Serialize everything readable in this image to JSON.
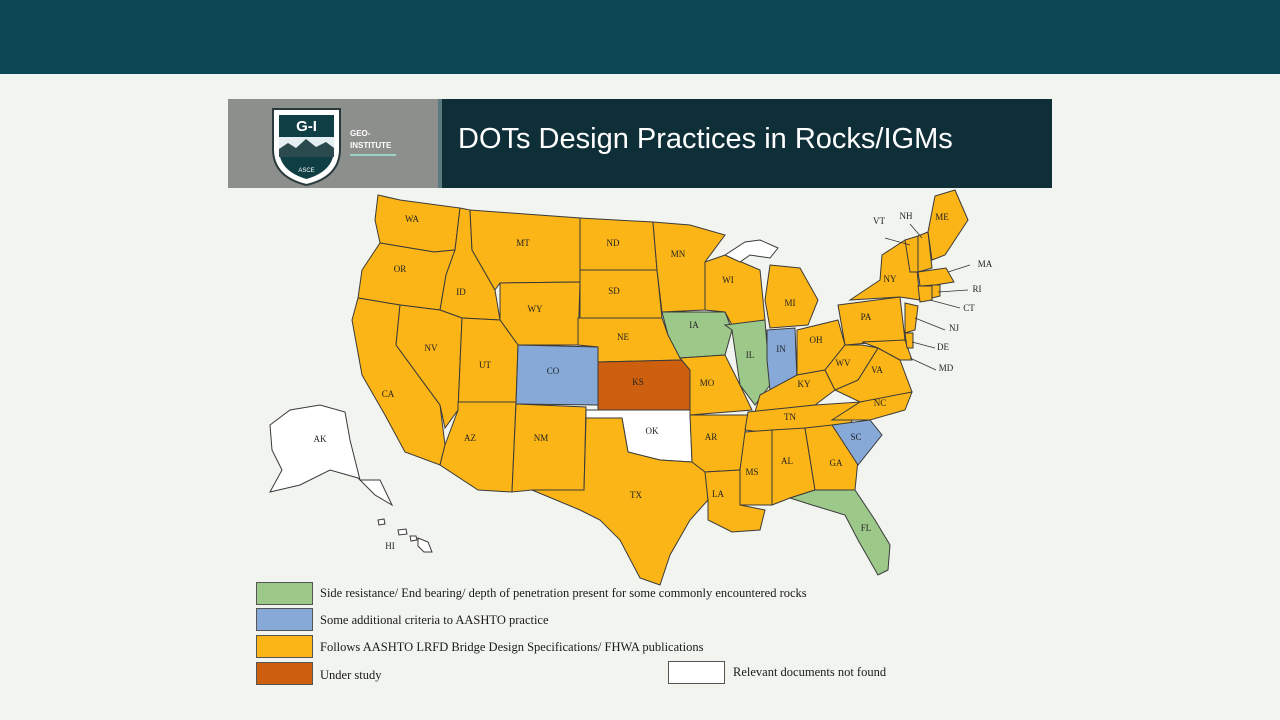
{
  "header": {
    "title": "DOTs Design Practices in Rocks/IGMs",
    "logo_text": "G-I",
    "logo_sub1": "GEO-",
    "logo_sub2": "INSTITUTE",
    "logo_org": "ASCE"
  },
  "colors": {
    "green": "#9cc98a",
    "blue": "#86a9d8",
    "orange": "#fbb516",
    "brown": "#cd5f0f",
    "white": "#ffffff",
    "header_bar": "#0c4753",
    "banner": "#0e2f38"
  },
  "states": {
    "WA": "WA",
    "OR": "OR",
    "CA": "CA",
    "ID": "ID",
    "NV": "NV",
    "MT": "MT",
    "WY": "WY",
    "UT": "UT",
    "AZ": "AZ",
    "CO": "CO",
    "NM": "NM",
    "ND": "ND",
    "SD": "SD",
    "NE": "NE",
    "KS": "KS",
    "OK": "OK",
    "TX": "TX",
    "MN": "MN",
    "IA": "IA",
    "MO": "MO",
    "AR": "AR",
    "LA": "LA",
    "WI": "WI",
    "IL": "IL",
    "MS": "MS",
    "MI": "MI",
    "IN": "IN",
    "KY": "KY",
    "TN": "TN",
    "AL": "AL",
    "GA": "GA",
    "FL": "FL",
    "SC": "SC",
    "NC": "NC",
    "VA": "VA",
    "WV": "WV",
    "OH": "OH",
    "PA": "PA",
    "NY": "NY",
    "VT": "VT",
    "NH": "NH",
    "ME": "ME",
    "MA": "MA",
    "RI": "RI",
    "CT": "CT",
    "NJ": "NJ",
    "DE": "DE",
    "MD": "MD",
    "AK": "AK",
    "HI": "HI"
  },
  "categories": {
    "green": [
      "IA",
      "IL",
      "FL"
    ],
    "blue": [
      "CO",
      "IN",
      "SC"
    ],
    "brown": [
      "KS"
    ],
    "white": [
      "OK",
      "AK",
      "HI"
    ]
  },
  "legend": {
    "green": "Side resistance/ End bearing/ depth of penetration present for some commonly encountered rocks",
    "blue": "Some additional  criteria to AASHTO practice",
    "orange": "Follows AASHTO LRFD Bridge Design Specifications/ FHWA publications",
    "brown": "Under study",
    "white": "Relevant documents not found"
  }
}
